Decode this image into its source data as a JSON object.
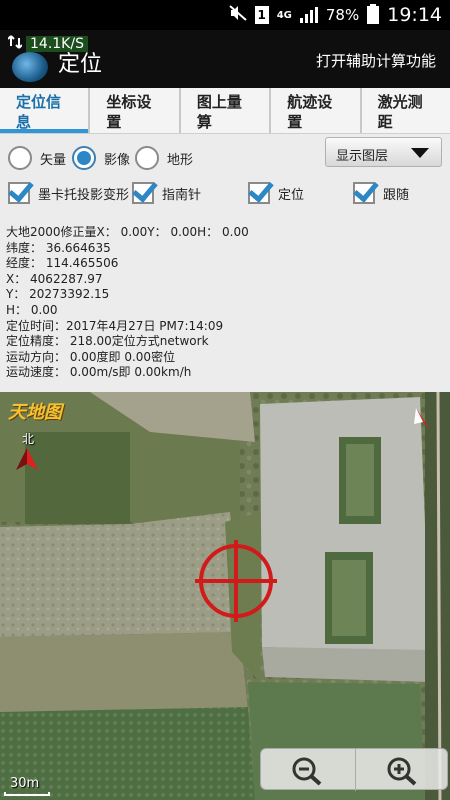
{
  "status": {
    "time": "19:14",
    "battery": "78%",
    "network": "4G",
    "sim": "1",
    "speed": "14.1K/S"
  },
  "appbar": {
    "title": "定位",
    "action": "打开辅助计算功能"
  },
  "tabs": [
    {
      "l1": "定位信",
      "l2": "息"
    },
    {
      "l1": "坐标设",
      "l2": "置"
    },
    {
      "l1": "图上量",
      "l2": "算"
    },
    {
      "l1": "航迹设",
      "l2": "置"
    },
    {
      "l1": "激光测",
      "l2": "距"
    }
  ],
  "map_mode": {
    "options": [
      "矢量",
      "影像",
      "地形"
    ],
    "selected": "影像"
  },
  "layer_button": "显示图层",
  "checkboxes": [
    "墨卡托投影变形",
    "指南针",
    "定位",
    "跟随"
  ],
  "info_lines": [
    "大地2000修正量X： 0.00Y： 0.00H： 0.00",
    "纬度： 36.664635",
    "经度： 114.465506",
    "X： 4062287.97",
    "Y： 20273392.15",
    "H： 0.00",
    "定位时间：2017年4月27日 PM7:14:09",
    "定位精度： 218.00定位方式network",
    "运动方向： 0.00度即 0.00密位",
    "运动速度： 0.00m/s即 0.00km/h"
  ],
  "map": {
    "logo": "天地图",
    "north_label": "北",
    "scale_label": "30m"
  },
  "colors": {
    "accent": "#2d86c6",
    "active_tab_text": "#1b6fa8",
    "crosshair": "#d11a1a"
  }
}
